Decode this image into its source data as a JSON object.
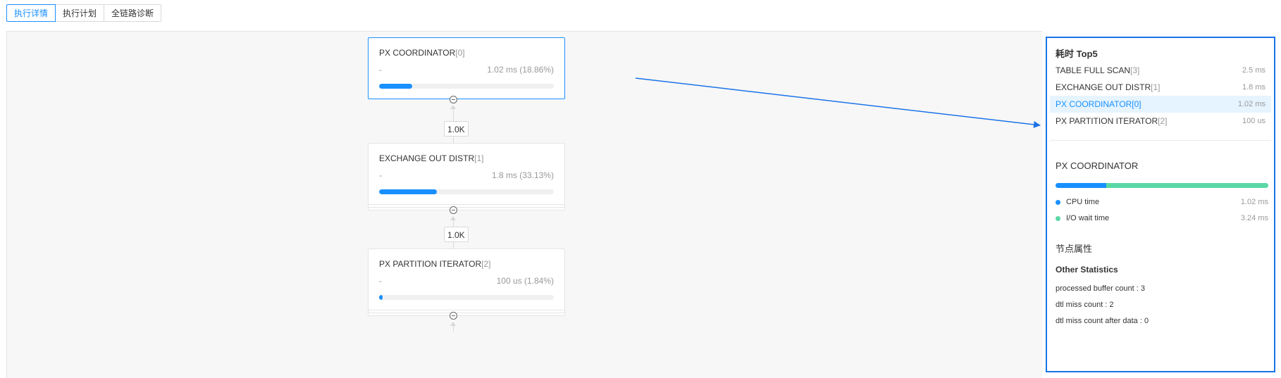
{
  "tabs": [
    {
      "label": "执行详情",
      "active": true
    },
    {
      "label": "执行计划",
      "active": false
    },
    {
      "label": "全链路诊断",
      "active": false
    }
  ],
  "plan": {
    "nodes": [
      {
        "name": "PX COORDINATOR",
        "index": "[0]",
        "dash": "-",
        "time": "1.02 ms (18.86%)",
        "percent": 18.86,
        "selected": true
      },
      {
        "name": "EXCHANGE OUT DISTR",
        "index": "[1]",
        "dash": "-",
        "time": "1.8 ms (33.13%)",
        "percent": 33.13,
        "selected": false
      },
      {
        "name": "PX PARTITION ITERATOR",
        "index": "[2]",
        "dash": "-",
        "time": "100 us (1.84%)",
        "percent": 1.84,
        "selected": false
      }
    ],
    "edges": [
      {
        "label": "1.0K"
      },
      {
        "label": "1.0K"
      }
    ]
  },
  "top5": {
    "title": "耗时 Top5",
    "items": [
      {
        "name": "TABLE FULL SCAN",
        "index": "[3]",
        "value": "2.5 ms",
        "active": false
      },
      {
        "name": "EXCHANGE OUT DISTR",
        "index": "[1]",
        "value": "1.8 ms",
        "active": false
      },
      {
        "name": "PX COORDINATOR",
        "index": "[0]",
        "value": "1.02 ms",
        "active": true
      },
      {
        "name": "PX PARTITION ITERATOR",
        "index": "[2]",
        "value": "100 us",
        "active": false
      }
    ]
  },
  "detail": {
    "title": "PX COORDINATOR",
    "cpu_fraction": 0.24,
    "legend": [
      {
        "label": "CPU time",
        "value": "1.02 ms",
        "color": "#1890ff"
      },
      {
        "label": "I/O wait time",
        "value": "3.24 ms",
        "color": "#5ad8a6"
      }
    ],
    "properties_title": "节点属性",
    "other_stats_title": "Other Statistics",
    "stats": [
      "processed buffer count : 3",
      "dtl miss count : 2",
      "dtl miss count after data : 0"
    ]
  },
  "colors": {
    "accent": "#1890ff",
    "annotation": "#1a73e8",
    "io": "#5ad8a6"
  }
}
